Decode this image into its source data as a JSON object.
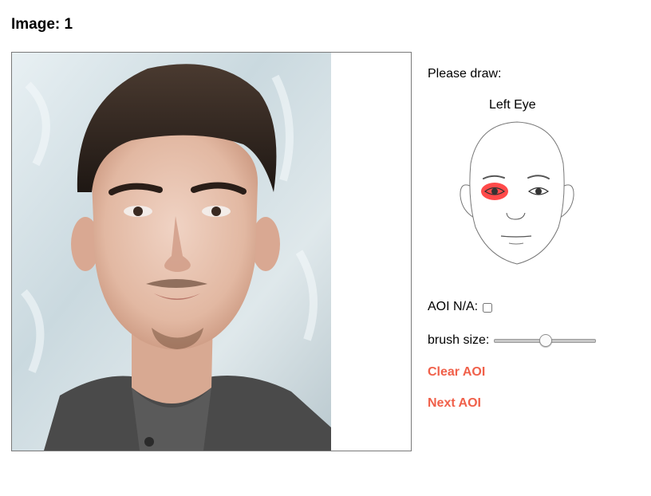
{
  "page": {
    "title": "Image: 1"
  },
  "panel": {
    "prompt": "Please draw:",
    "aoi_name": "Left Eye",
    "aoi_na_label": "AOI N/A:",
    "aoi_na_checked": false,
    "brush_size_label": "brush size:",
    "brush_size_level": 0.5,
    "clear_label": "Clear AOI",
    "next_label": "Next AOI"
  },
  "colors": {
    "link": "#f0604a",
    "highlight": "#ff2a2a"
  },
  "icons": {
    "face_diagram": "face-outline-icon",
    "highlighted_region": "left-eye-highlight-icon"
  }
}
